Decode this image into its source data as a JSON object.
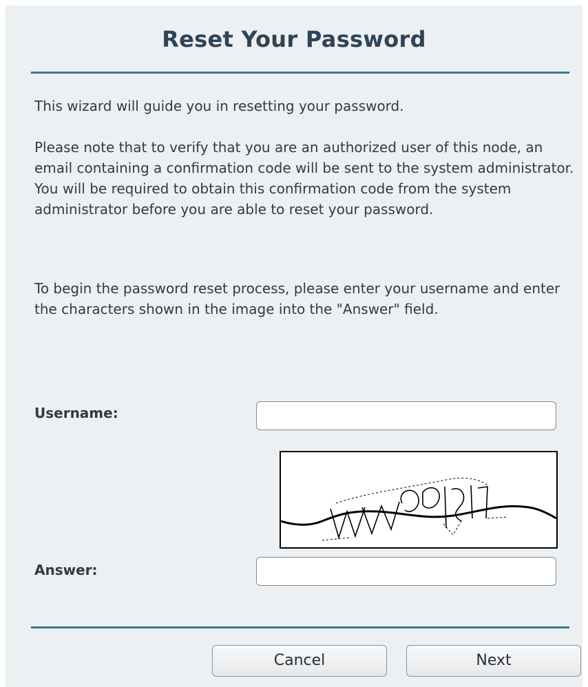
{
  "dialog": {
    "title": "Reset Your Password",
    "intro": "This wizard will guide you in resetting your password.",
    "note": "Please note that to verify that you are an authorized user of this node, an email containing a confirmation code will be sent to the system administrator. You will be required to obtain this confirmation code from the system administrator before you are able to reset your password.",
    "instructions": "To begin the password reset process, please enter your username and enter the characters shown in the image into the \"Answer\" field."
  },
  "form": {
    "username_label": "Username:",
    "username_value": "",
    "answer_label": "Answer:",
    "answer_value": "",
    "captcha_image": "captcha-image"
  },
  "buttons": {
    "cancel_label": "Cancel",
    "next_label": "Next"
  },
  "colors": {
    "background": "#edf0f2",
    "rule": "#3b7790",
    "title": "#2e4457"
  }
}
